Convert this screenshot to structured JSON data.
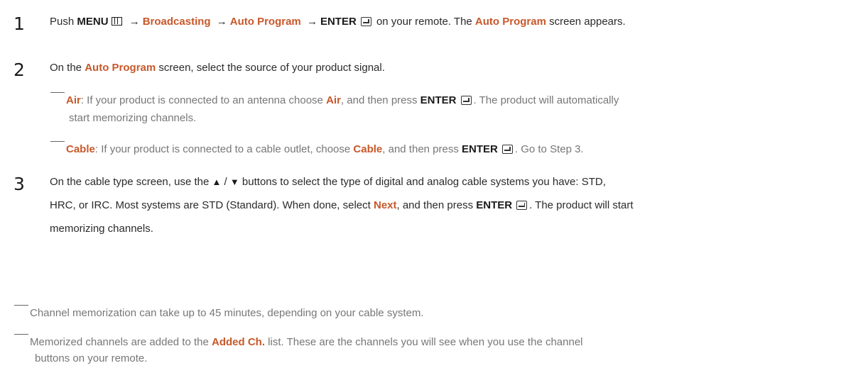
{
  "steps": [
    {
      "number": "1",
      "parts": {
        "push": "Push",
        "menu": "MENU",
        "broadcasting": "Broadcasting",
        "auto_program": "Auto Program",
        "enter": "ENTER",
        "on_remote": "on your remote. The",
        "auto_program_2": "Auto Program",
        "screen_appears": "screen appears."
      },
      "icons": [
        "menu-icon",
        "arrow-right-icon",
        "enter-icon"
      ]
    },
    {
      "number": "2",
      "parts": {
        "on_the": "On the",
        "auto_program": "Auto Program",
        "rest": "screen, select the source of your product signal."
      },
      "subs": [
        {
          "term": "Air",
          "text_a": ": If your product is connected to an antenna choose",
          "term_2": "Air",
          "text_b": ", and then press",
          "enter": "ENTER",
          "text_c": ". The product will automatically",
          "text_d": "start memorizing channels."
        },
        {
          "term": "Cable",
          "text_a": ": If your product is connected to a cable outlet, choose",
          "term_2": "Cable",
          "text_b": ", and then press",
          "enter": "ENTER",
          "text_c": ". Go to Step 3."
        }
      ]
    },
    {
      "number": "3",
      "parts": {
        "a": "On the cable type screen, use the",
        "up": "▲",
        "slash": "/",
        "down": "▼",
        "b": "buttons to select the type of digital and analog cable systems you have: STD,",
        "c": "HRC, or IRC. Most systems are STD (Standard). When done, select",
        "next": "Next",
        "d": ", and then press",
        "enter": "ENTER",
        "e": ". The product will start",
        "f": "memorizing channels."
      }
    }
  ],
  "notes": [
    {
      "text": "Channel memorization can take up to 45 minutes, depending on your cable system."
    },
    {
      "a": "Memorized channels are added to the",
      "term": "Added Ch.",
      "b": "list. These are the channels you will see when you use the channel",
      "c": "buttons on your remote."
    }
  ],
  "colors": {
    "accent": "#c8582a",
    "text": "#2a2a2a",
    "note": "#777777"
  }
}
